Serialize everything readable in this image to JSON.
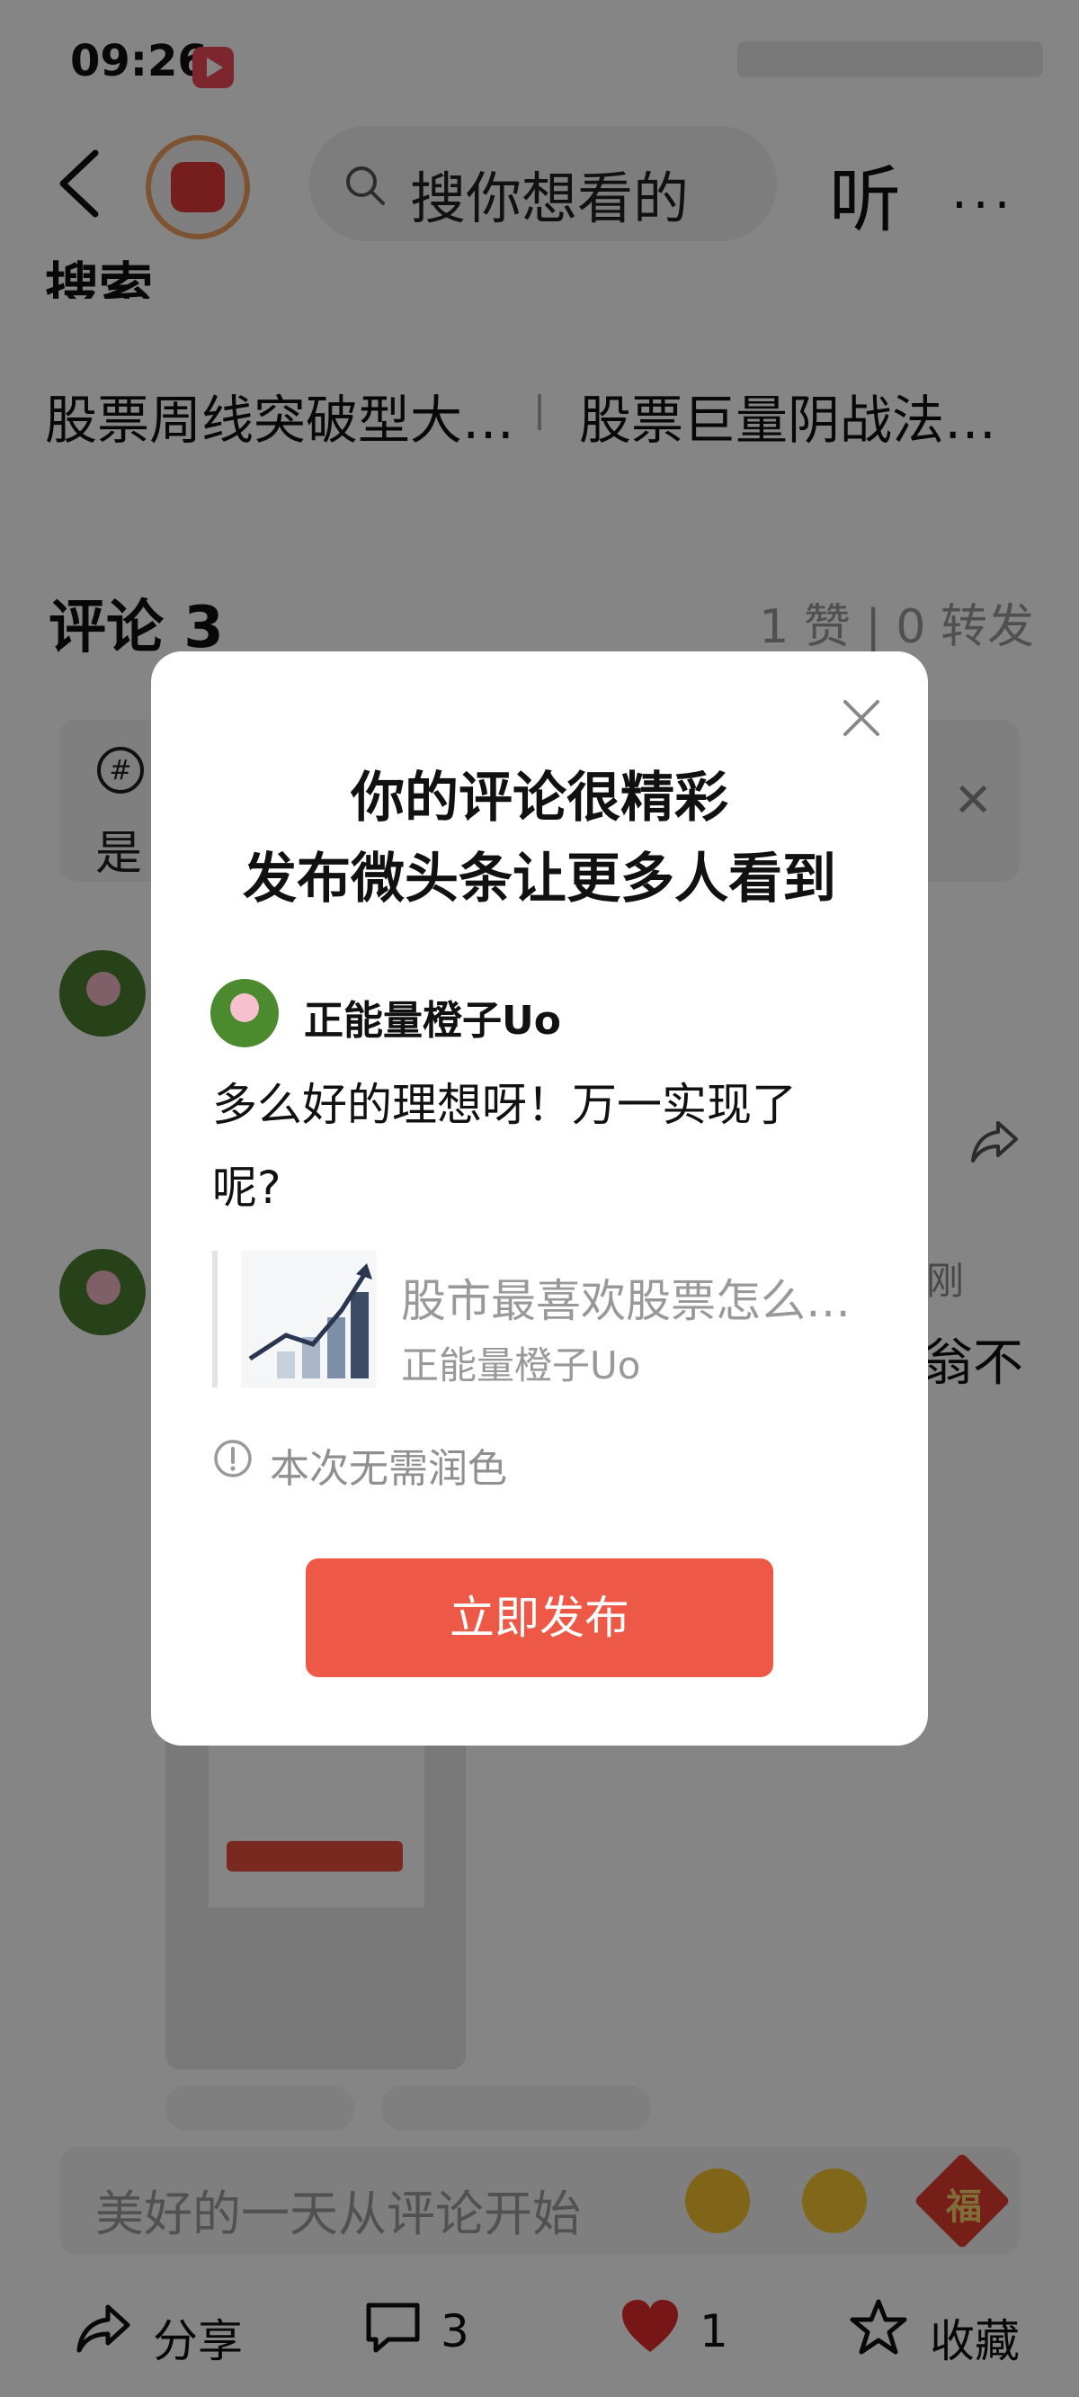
{
  "status_bar": {
    "time": "09:26"
  },
  "top_bar": {
    "search_placeholder": "搜你想看的",
    "listen_label": "听",
    "more_label": "···"
  },
  "related": {
    "section_partial": "搜索",
    "items": [
      "股票周线突破型大…",
      "股票巨量阴战法…"
    ]
  },
  "comments": {
    "title": "评论 3",
    "stats": "1 赞 | 0 转发",
    "topic_partial": "是",
    "partial_name": "刚",
    "partial_text": "翁不"
  },
  "input_bar": {
    "placeholder": "美好的一天从评论开始",
    "fu_label": "福"
  },
  "bottom_bar": {
    "share": "分享",
    "comments_count": "3",
    "likes_count": "1",
    "favorite": "收藏"
  },
  "modal": {
    "title_line1": "你的评论很精彩",
    "title_line2": "发布微头条让更多人看到",
    "username": "正能量橙子Uo",
    "comment": "多么好的理想呀！万一实现了呢?",
    "quote_title": "股市最喜欢股票怎么…",
    "quote_author": "正能量橙子Uo",
    "info": "本次无需润色",
    "publish_button": "立即发布"
  },
  "colors": {
    "accent": "#ee5846",
    "overlay": "rgba(0,0,0,0.48)"
  }
}
